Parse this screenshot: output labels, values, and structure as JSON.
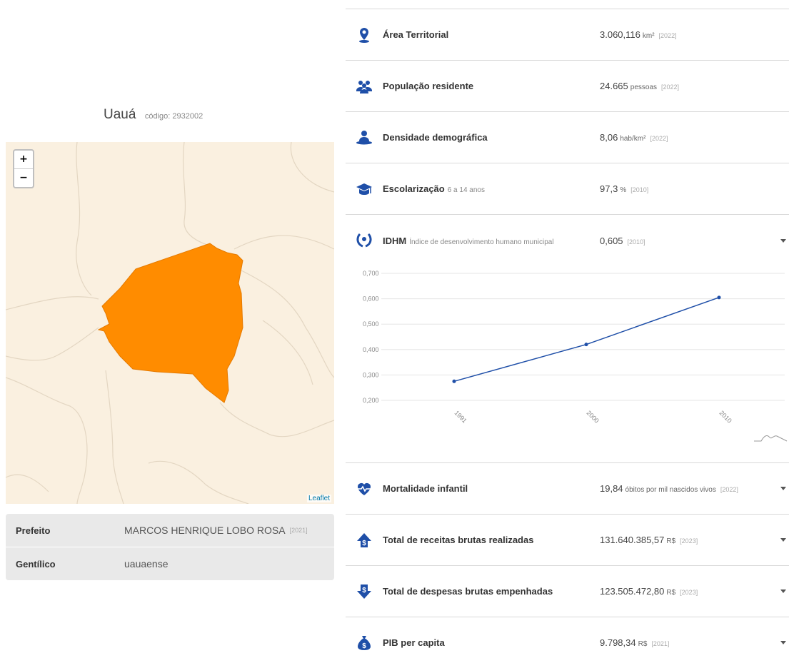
{
  "municipality": {
    "name": "Uauá",
    "code_label": "código: 2932002"
  },
  "map": {
    "zoom_in": "+",
    "zoom_out": "−",
    "attribution": "Leaflet",
    "fill_color": "#ff8c00",
    "background_color": "#faf0e0"
  },
  "info_table": [
    {
      "label": "Prefeito",
      "value": "MARCOS HENRIQUE LOBO ROSA",
      "year": "[2021]"
    },
    {
      "label": "Gentílico",
      "value": "uauaense",
      "year": ""
    }
  ],
  "indicators": [
    {
      "icon": "map-pin-icon",
      "label": "Área Territorial",
      "sub": "",
      "value": "3.060,116",
      "unit": "km²",
      "year": "[2022]",
      "expandable": false
    },
    {
      "icon": "people-icon",
      "label": "População residente",
      "sub": "",
      "value": "24.665",
      "unit": "pessoas",
      "year": "[2022]",
      "expandable": false
    },
    {
      "icon": "person-icon",
      "label": "Densidade demográfica",
      "sub": "",
      "value": "8,06",
      "unit": "hab/km²",
      "year": "[2022]",
      "expandable": false
    },
    {
      "icon": "graduation-cap-icon",
      "label": "Escolarização",
      "sub": "6 a 14 anos",
      "value": "97,3",
      "unit": "%",
      "year": "[2010]",
      "expandable": false
    }
  ],
  "idhm": {
    "icon": "laurel-icon",
    "label": "IDHM",
    "sub": "Índice de desenvolvimento humano municipal",
    "value": "0,605",
    "unit": "",
    "year": "[2010]"
  },
  "chart_data": {
    "type": "line",
    "x": [
      "1991",
      "2000",
      "2010"
    ],
    "series": [
      {
        "values": [
          0.275,
          0.42,
          0.605
        ]
      }
    ],
    "y_ticks": [
      "0,700",
      "0,600",
      "0,500",
      "0,400",
      "0,300",
      "0,200"
    ],
    "ylim": [
      0.2,
      0.7
    ],
    "grid": true,
    "line_color": "#1f4fa8"
  },
  "indicators_bottom": [
    {
      "icon": "heartbeat-icon",
      "label": "Mortalidade infantil",
      "sub": "",
      "value": "19,84",
      "unit": "óbitos por mil nascidos vivos",
      "year": "[2022]",
      "expandable": true
    },
    {
      "icon": "money-up-icon",
      "label": "Total de receitas brutas realizadas",
      "sub": "",
      "value": "131.640.385,57",
      "unit": "R$",
      "year": "[2023]",
      "expandable": true
    },
    {
      "icon": "money-down-icon",
      "label": "Total de despesas brutas empenhadas",
      "sub": "",
      "value": "123.505.472,80",
      "unit": "R$",
      "year": "[2023]",
      "expandable": true
    },
    {
      "icon": "money-bag-icon",
      "label": "PIB per capita",
      "sub": "",
      "value": "9.798,34",
      "unit": "R$",
      "year": "[2021]",
      "expandable": true
    }
  ],
  "colors": {
    "icon_blue": "#1f4fa8"
  }
}
